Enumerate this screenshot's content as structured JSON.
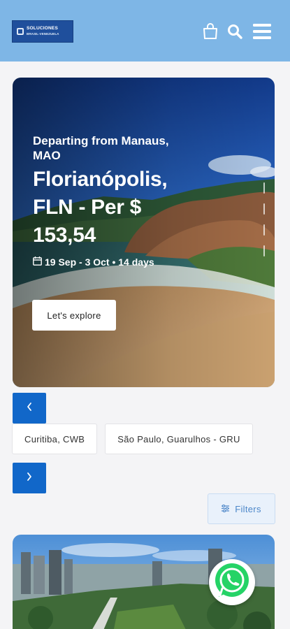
{
  "header": {
    "logo_line1": "SOLUCIONES",
    "logo_line2": "BRASIL-VENEZUELA",
    "icons": [
      "shopping-bag-icon",
      "search-icon",
      "hamburger-menu-icon"
    ],
    "background_color": "#7eb6e6"
  },
  "hero": {
    "departing": "Departing from Manaus, MAO",
    "title": "Florianópolis, FLN - Per $ 153,54",
    "dates": "19 Sep - 3 Oct • 14 days",
    "cta_label": "Let's explore",
    "date_icon": "calendar-icon"
  },
  "carousel": {
    "prev_icon": "chevron-left-icon",
    "next_icon": "chevron-right-icon",
    "button_color": "#1167c9",
    "chips": [
      "Curitiba, CWB",
      "São Paulo, Guarulhos - GRU"
    ]
  },
  "filters": {
    "label": "Filters",
    "icon": "filter-icon"
  },
  "floating": {
    "icon": "whatsapp-icon",
    "color": "#25d366"
  }
}
